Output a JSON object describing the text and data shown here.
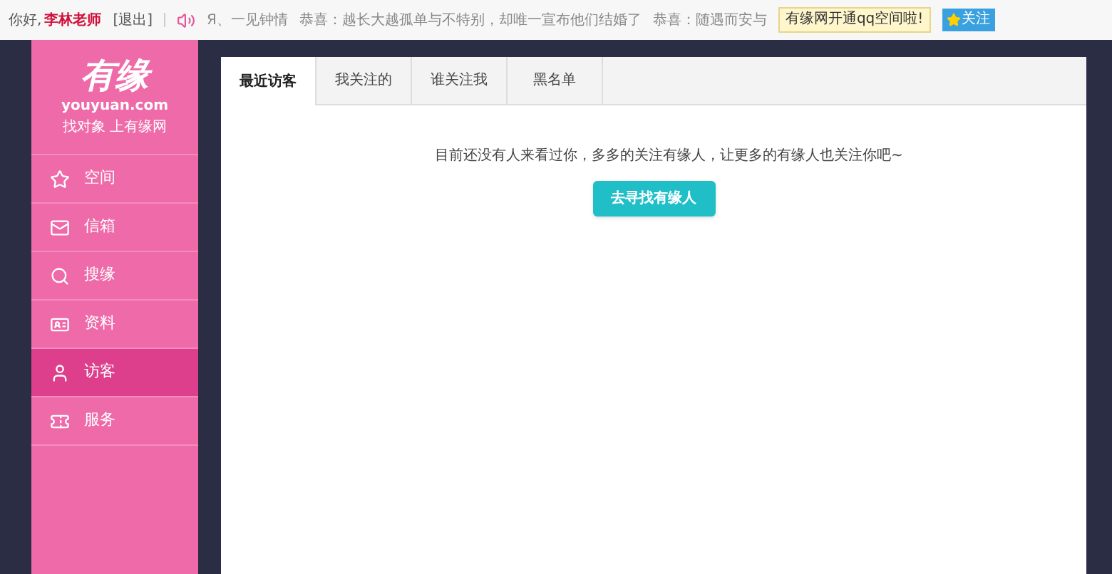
{
  "top_bar": {
    "greeting": "你好,",
    "username": "李林老师",
    "logout": "[退出]",
    "ticker": [
      "Я、一见钟情",
      "恭喜：越长大越孤单与不特别，却唯一宣布他们结婚了",
      "恭喜：随遇而安与"
    ],
    "notice": "有缘网开通qq空间啦!",
    "follow_button": "关注"
  },
  "sidebar": {
    "logo": {
      "title": "有缘",
      "domain": "youyuan.com",
      "slogan": "找对象 上有缘网"
    },
    "items": [
      {
        "kind": "star",
        "label": "空间",
        "selected": false
      },
      {
        "kind": "mail",
        "label": "信箱",
        "selected": false
      },
      {
        "kind": "search",
        "label": "搜缘",
        "selected": false
      },
      {
        "kind": "card",
        "label": "资料",
        "selected": false
      },
      {
        "kind": "user",
        "label": "访客",
        "selected": true
      },
      {
        "kind": "ticket",
        "label": "服务",
        "selected": false
      }
    ]
  },
  "tabs": [
    {
      "label": "最近访客",
      "selected": true
    },
    {
      "label": "我关注的",
      "selected": false
    },
    {
      "label": "谁关注我",
      "selected": false
    },
    {
      "label": "黑名单",
      "selected": false
    }
  ],
  "empty_message": "目前还没有人来看过你，多多的关注有缘人，让更多的有缘人也关注你吧~",
  "find_button": "去寻找有缘人"
}
